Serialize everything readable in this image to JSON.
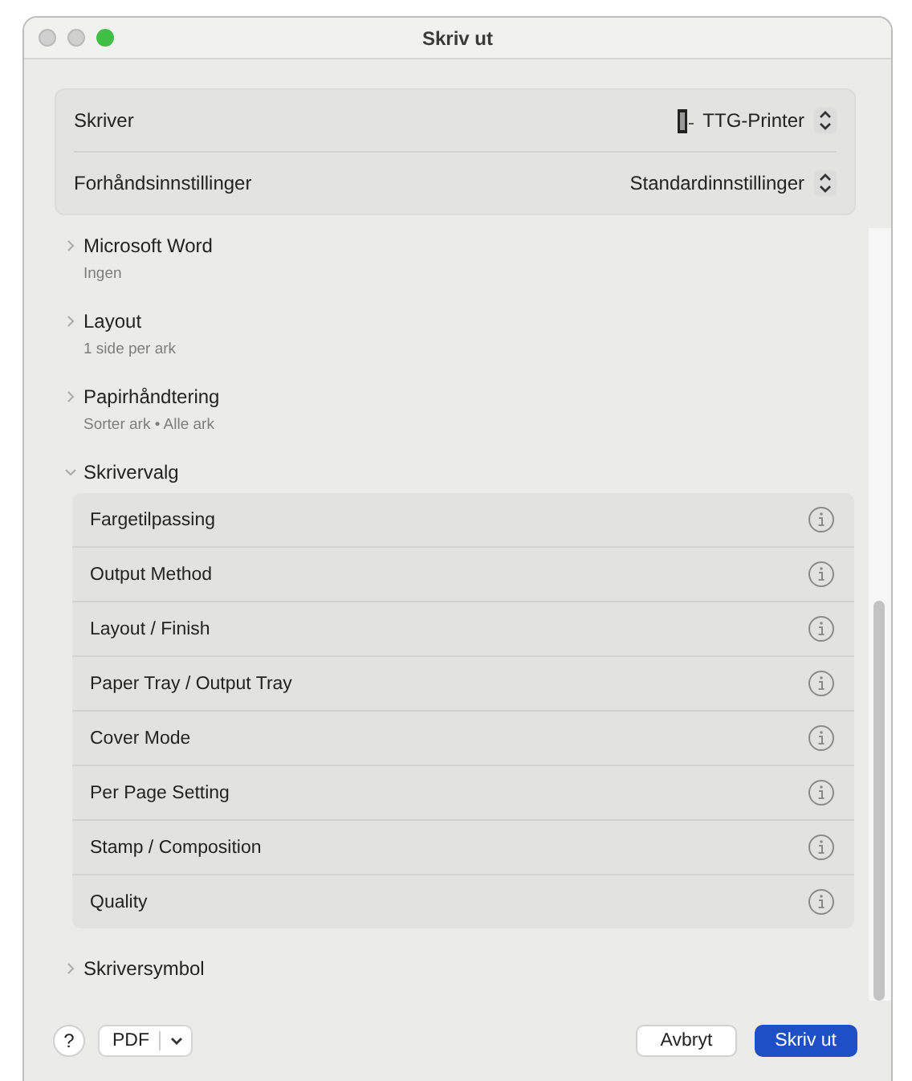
{
  "window": {
    "title": "Skriv ut"
  },
  "settings": [
    {
      "label": "Skriver",
      "value": "TTG-Printer",
      "kind": "printer"
    },
    {
      "label": "Forhåndsinnstillinger",
      "value": "Standardinnstillinger",
      "kind": "plain"
    }
  ],
  "sections": [
    {
      "title": "Microsoft Word",
      "summary": "Ingen",
      "expanded": false
    },
    {
      "title": "Layout",
      "summary": "1 side per ark",
      "expanded": false
    },
    {
      "title": "Papirhåndtering",
      "summary": "Sorter ark • Alle ark",
      "expanded": false
    },
    {
      "title": "Skrivervalg",
      "expanded": true,
      "children": [
        {
          "label": "Fargetilpassing"
        },
        {
          "label": "Output Method"
        },
        {
          "label": "Layout / Finish"
        },
        {
          "label": "Paper Tray / Output Tray"
        },
        {
          "label": "Cover Mode"
        },
        {
          "label": "Per Page Setting"
        },
        {
          "label": "Stamp / Composition"
        },
        {
          "label": "Quality"
        }
      ]
    },
    {
      "title": "Skriversymbol",
      "expanded": false
    }
  ],
  "footer": {
    "help": "?",
    "pdf": "PDF",
    "cancel": "Avbryt",
    "print": "Skriv ut"
  }
}
